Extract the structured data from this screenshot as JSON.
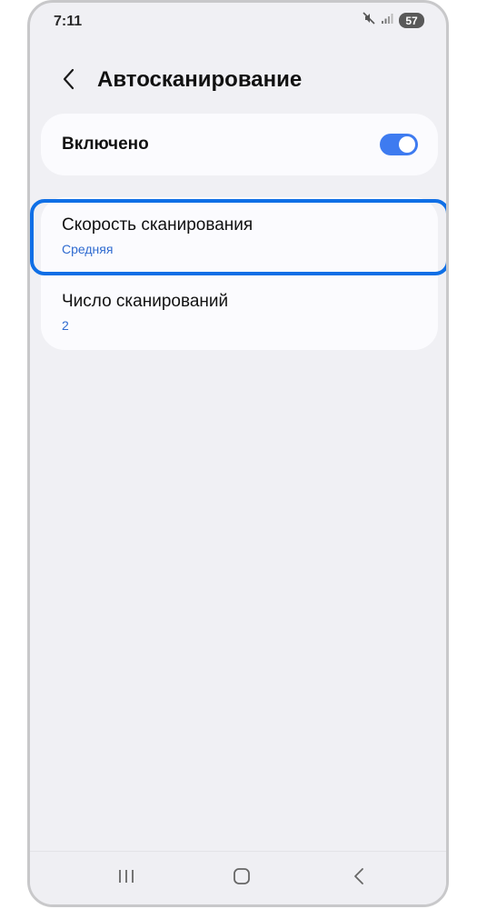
{
  "status_bar": {
    "time": "7:11",
    "battery": "57",
    "icons": [
      "mute-icon",
      "signal-icon",
      "battery-icon"
    ]
  },
  "header": {
    "title": "Автосканирование",
    "back_icon": "chevron-left-icon"
  },
  "toggle_card": {
    "label": "Включено",
    "enabled": true,
    "accent_color": "#3e7bf0"
  },
  "settings": [
    {
      "title": "Скорость сканирования",
      "value": "Средняя",
      "highlighted": true
    },
    {
      "title": "Число сканирований",
      "value": "2",
      "highlighted": false
    }
  ],
  "colors": {
    "value_text": "#2f6bd0",
    "highlight_border": "#0f6fe6",
    "background": "#f0f0f4",
    "card": "#fbfbfe"
  },
  "nav_bar": {
    "icons": [
      "recent-apps-icon",
      "home-icon",
      "back-icon"
    ]
  }
}
